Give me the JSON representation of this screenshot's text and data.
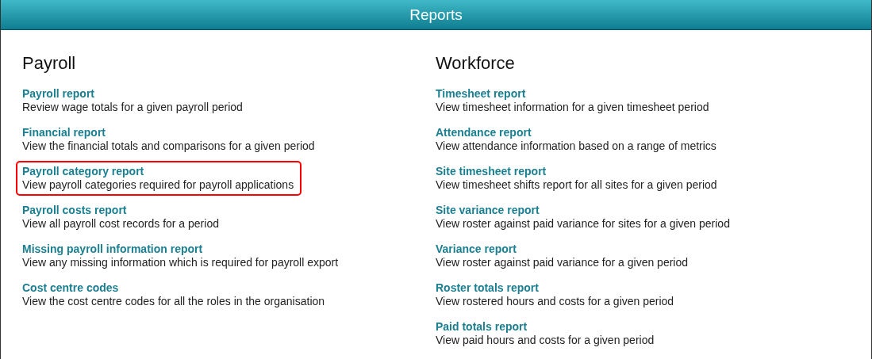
{
  "header": {
    "title": "Reports"
  },
  "sections": [
    {
      "title": "Payroll",
      "items": [
        {
          "title": "Payroll report",
          "description": "Review wage totals for a given payroll period",
          "highlighted": false
        },
        {
          "title": "Financial report",
          "description": "View the financial totals and comparisons for a given period",
          "highlighted": false
        },
        {
          "title": "Payroll category report",
          "description": "View payroll categories required for payroll applications",
          "highlighted": true
        },
        {
          "title": "Payroll costs report",
          "description": "View all payroll cost records for a period",
          "highlighted": false
        },
        {
          "title": "Missing payroll information report",
          "description": "View any missing information which is required for payroll export",
          "highlighted": false
        },
        {
          "title": "Cost centre codes",
          "description": "View the cost centre codes for all the roles in the organisation",
          "highlighted": false
        }
      ]
    },
    {
      "title": "Workforce",
      "items": [
        {
          "title": "Timesheet report",
          "description": "View timesheet information for a given timesheet period",
          "highlighted": false
        },
        {
          "title": "Attendance report",
          "description": "View attendance information based on a range of metrics",
          "highlighted": false
        },
        {
          "title": "Site timesheet report",
          "description": "View timesheet shifts report for all sites for a given period",
          "highlighted": false
        },
        {
          "title": "Site variance report",
          "description": "View roster against paid variance for sites for a given period",
          "highlighted": false
        },
        {
          "title": "Variance report",
          "description": "View roster against paid variance for a given period",
          "highlighted": false
        },
        {
          "title": "Roster totals report",
          "description": "View rostered hours and costs for a given period",
          "highlighted": false
        },
        {
          "title": "Paid totals report",
          "description": "View paid hours and costs for a given period",
          "highlighted": false
        }
      ]
    }
  ]
}
